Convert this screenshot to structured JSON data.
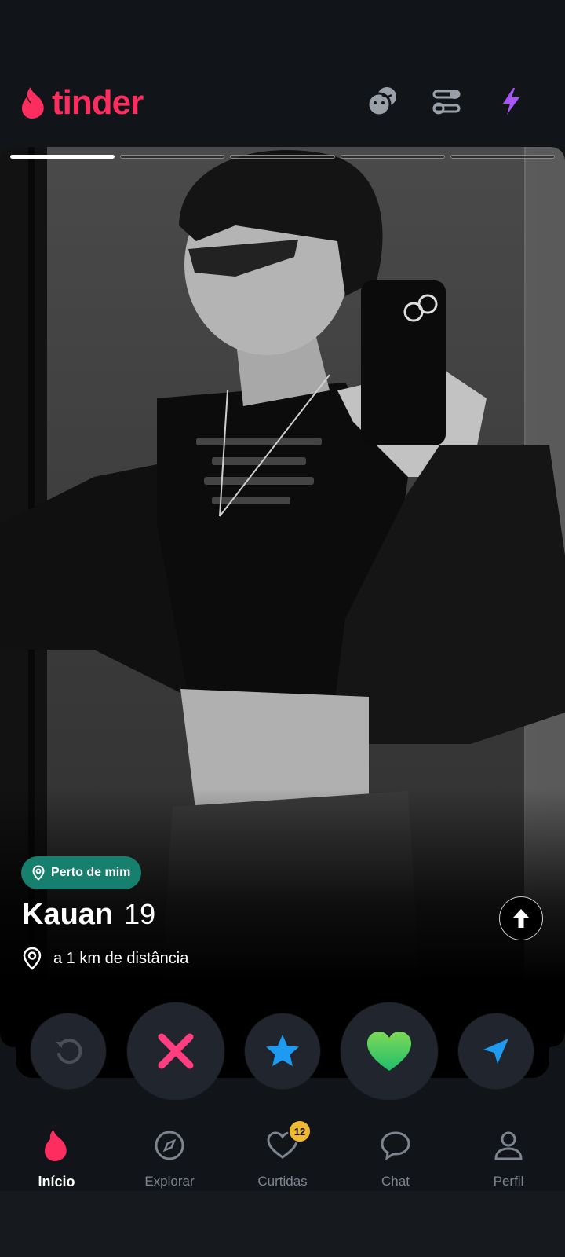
{
  "header": {
    "logo_text": "tinder",
    "icons": [
      "double-date-icon",
      "filters-icon",
      "boost-icon"
    ]
  },
  "profile": {
    "photo_count": 5,
    "active_photo": 1,
    "near_badge": "Perto de mim",
    "name": "Kauan",
    "age": "19",
    "distance": "a 1 km de distância"
  },
  "actions": [
    "rewind-icon",
    "nope-icon",
    "super-like-icon",
    "like-icon",
    "super-boost-icon"
  ],
  "nav": {
    "items": [
      {
        "label": "Início",
        "icon": "flame-icon",
        "active": true
      },
      {
        "label": "Explorar",
        "icon": "compass-icon"
      },
      {
        "label": "Curtidas",
        "icon": "heart-icon",
        "badge": "12"
      },
      {
        "label": "Chat",
        "icon": "chat-icon"
      },
      {
        "label": "Perfil",
        "icon": "person-icon"
      }
    ]
  },
  "colors": {
    "brand": "#fd2e5f",
    "near_badge": "#177f6e",
    "super_like": "#1e9bf0",
    "like": "#4cd964",
    "boost": "#a855f7",
    "badge": "#f0b930"
  }
}
